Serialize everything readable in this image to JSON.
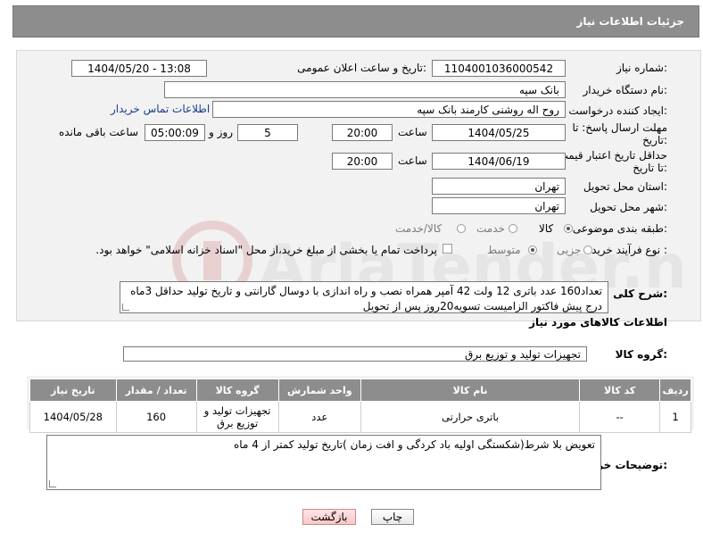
{
  "header": {
    "title": "جزئیات اطلاعات نیاز"
  },
  "form": {
    "need_number": {
      "label": "شماره نیاز:",
      "value": "1104001036000542"
    },
    "announce": {
      "label": "تاریخ و ساعت اعلان عمومی:",
      "value": "1404/05/20 - 13:08"
    },
    "buyer_org": {
      "label": "نام دستگاه خریدار:",
      "value": "بانک سپه"
    },
    "requester": {
      "label": "ایجاد کننده درخواست:",
      "value": "روح اله روشنی کارمند بانک سپه",
      "contact_link": "اطلاعات تماس خریدار"
    },
    "deadline": {
      "label": "مهلت ارسال پاسخ: تا تاریخ:",
      "date": "1404/05/25",
      "time_label": "ساعت",
      "time": "20:00",
      "days": "5",
      "days_label": "روز و",
      "remaining": "05:00:09",
      "remaining_label": "ساعت باقی مانده"
    },
    "price_validity": {
      "label": "حداقل تاریخ اعتبار قیمت: تا تاریخ:",
      "date": "1404/06/19",
      "time_label": "ساعت",
      "time": "20:00"
    },
    "province": {
      "label": "استان محل تحویل:",
      "value": "تهران"
    },
    "city": {
      "label": "شهر محل تحویل:",
      "value": "تهران"
    },
    "category": {
      "label": "طبقه بندی موضوعی:",
      "options": [
        "کالا",
        "خدمت",
        "کالا/خدمت"
      ],
      "selected": "کالا"
    },
    "process": {
      "label": "نوع فرآیند خرید :",
      "options": [
        "جزیی",
        "متوسط"
      ],
      "selected": "متوسط",
      "payment_note": "پرداخت تمام یا بخشی از مبلغ خرید،از محل \"اسناد خزانه اسلامی\" خواهد بود."
    }
  },
  "summary": {
    "label": "شرح کلی نیاز:",
    "text": "تعداد160 عدد باتری 12 ولت 42 آمپر همراه نصب و راه اندازی با دوسال گارانتی و تاریخ تولید حداقل 3ماه درج پیش فاکتور الزامیست تسویه20روز پس از تحویل"
  },
  "goods_section": {
    "title": "اطلاعات کالاهای مورد نیاز",
    "group_label": "گروه کالا:",
    "group_value": "تجهیزات تولید و توزیع برق"
  },
  "table": {
    "headers": [
      "ردیف",
      "کد کالا",
      "نام کالا",
      "واحد شمارش",
      "گروه کالا",
      "تعداد / مقدار",
      "تاریخ نیاز"
    ],
    "rows": [
      [
        "1",
        "--",
        "باتری حرارتی",
        "عدد",
        "تجهیزات تولید و توزیع برق",
        "160",
        "1404/05/28"
      ]
    ]
  },
  "buyer_notes": {
    "label": "توضیحات خریدار:",
    "text": "تعویض بلا شرط(شکستگی اولیه باد کردگی و افت زمان )تاریخ تولید کمتر از 4 ماه"
  },
  "buttons": {
    "print": "چاپ",
    "back": "بازگشت"
  },
  "watermark": {
    "text": "AriaTender.neT"
  }
}
